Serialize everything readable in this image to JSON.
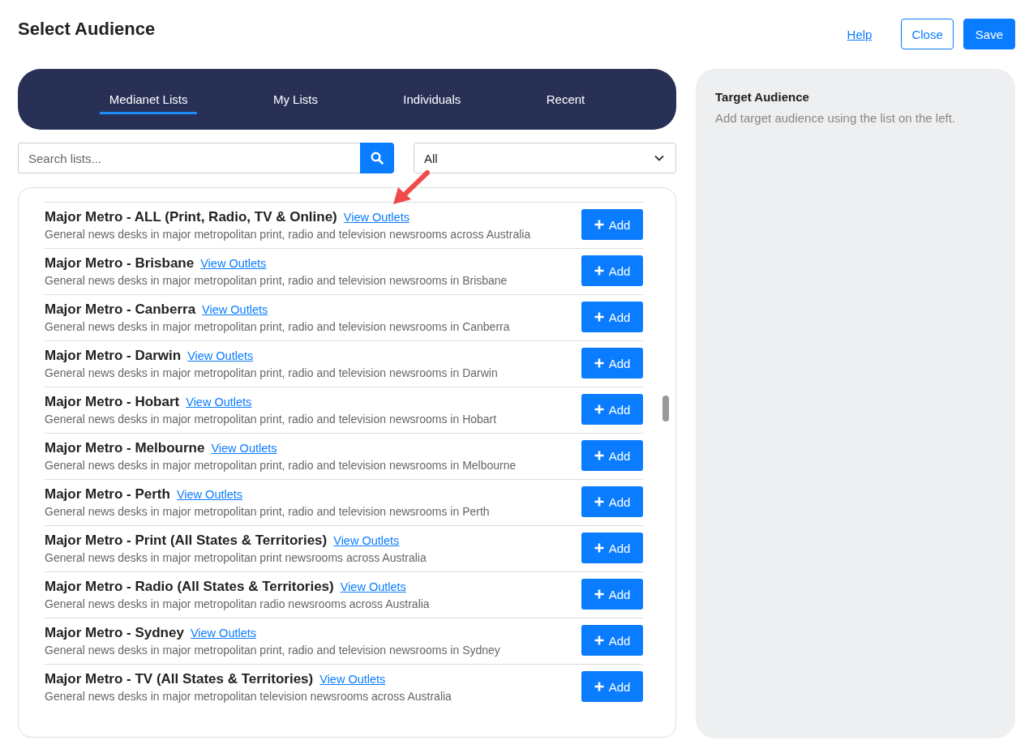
{
  "header": {
    "title": "Select Audience",
    "buttons": [
      {
        "label": "Help",
        "kind": "link"
      },
      {
        "label": "Close",
        "kind": "outline"
      },
      {
        "label": "Save",
        "kind": "primary"
      }
    ]
  },
  "tabs": [
    {
      "label": "Medianet Lists",
      "selected": true
    },
    {
      "label": "My Lists",
      "selected": false
    },
    {
      "label": "Individuals",
      "selected": false
    },
    {
      "label": "Recent",
      "selected": false
    }
  ],
  "search": {
    "placeholder": "Search lists..."
  },
  "filter": {
    "value": "All"
  },
  "lists": [
    {
      "name": "Major Metro - ALL (Print, Radio, TV & Online)",
      "link": "View Outlets",
      "description": "General news desks in major metropolitan print, radio and television newsrooms across Australia",
      "button": "Add"
    },
    {
      "name": "Major Metro - Brisbane",
      "link": "View Outlets",
      "description": "General news desks in major metropolitan print, radio and television newsrooms in Brisbane",
      "button": "Add"
    },
    {
      "name": "Major Metro - Canberra",
      "link": "View Outlets",
      "description": "General news desks in major metropolitan print, radio and television newsrooms in Canberra",
      "button": "Add"
    },
    {
      "name": "Major Metro - Darwin",
      "link": "View Outlets",
      "description": "General news desks in major metropolitan print, radio and television newsrooms in Darwin",
      "button": "Add"
    },
    {
      "name": "Major Metro - Hobart",
      "link": "View Outlets",
      "description": "General news desks in major metropolitan print, radio and television newsrooms in Hobart",
      "button": "Add"
    },
    {
      "name": "Major Metro - Melbourne",
      "link": "View Outlets",
      "description": "General news desks in major metropolitan print, radio and television newsrooms in Melbourne",
      "button": "Add"
    },
    {
      "name": "Major Metro - Perth",
      "link": "View Outlets",
      "description": "General news desks in major metropolitan print, radio and television newsrooms in Perth",
      "button": "Add"
    },
    {
      "name": "Major Metro - Print (All States & Territories)",
      "link": "View Outlets",
      "description": "General news desks in major metropolitan print newsrooms across Australia",
      "button": "Add"
    },
    {
      "name": "Major Metro - Radio (All States & Territories)",
      "link": "View Outlets",
      "description": "General news desks in major metropolitan radio newsrooms across Australia",
      "button": "Add"
    },
    {
      "name": "Major Metro - Sydney",
      "link": "View Outlets",
      "description": "General news desks in major metropolitan print, radio and television newsrooms in Sydney",
      "button": "Add"
    },
    {
      "name": "Major Metro - TV (All States & Territories)",
      "link": "View Outlets",
      "description": "General news desks in major metropolitan television newsrooms across Australia",
      "button": "Add"
    }
  ],
  "target": {
    "title": "Target Audience",
    "hint": "Add target audience using the list on the left."
  }
}
